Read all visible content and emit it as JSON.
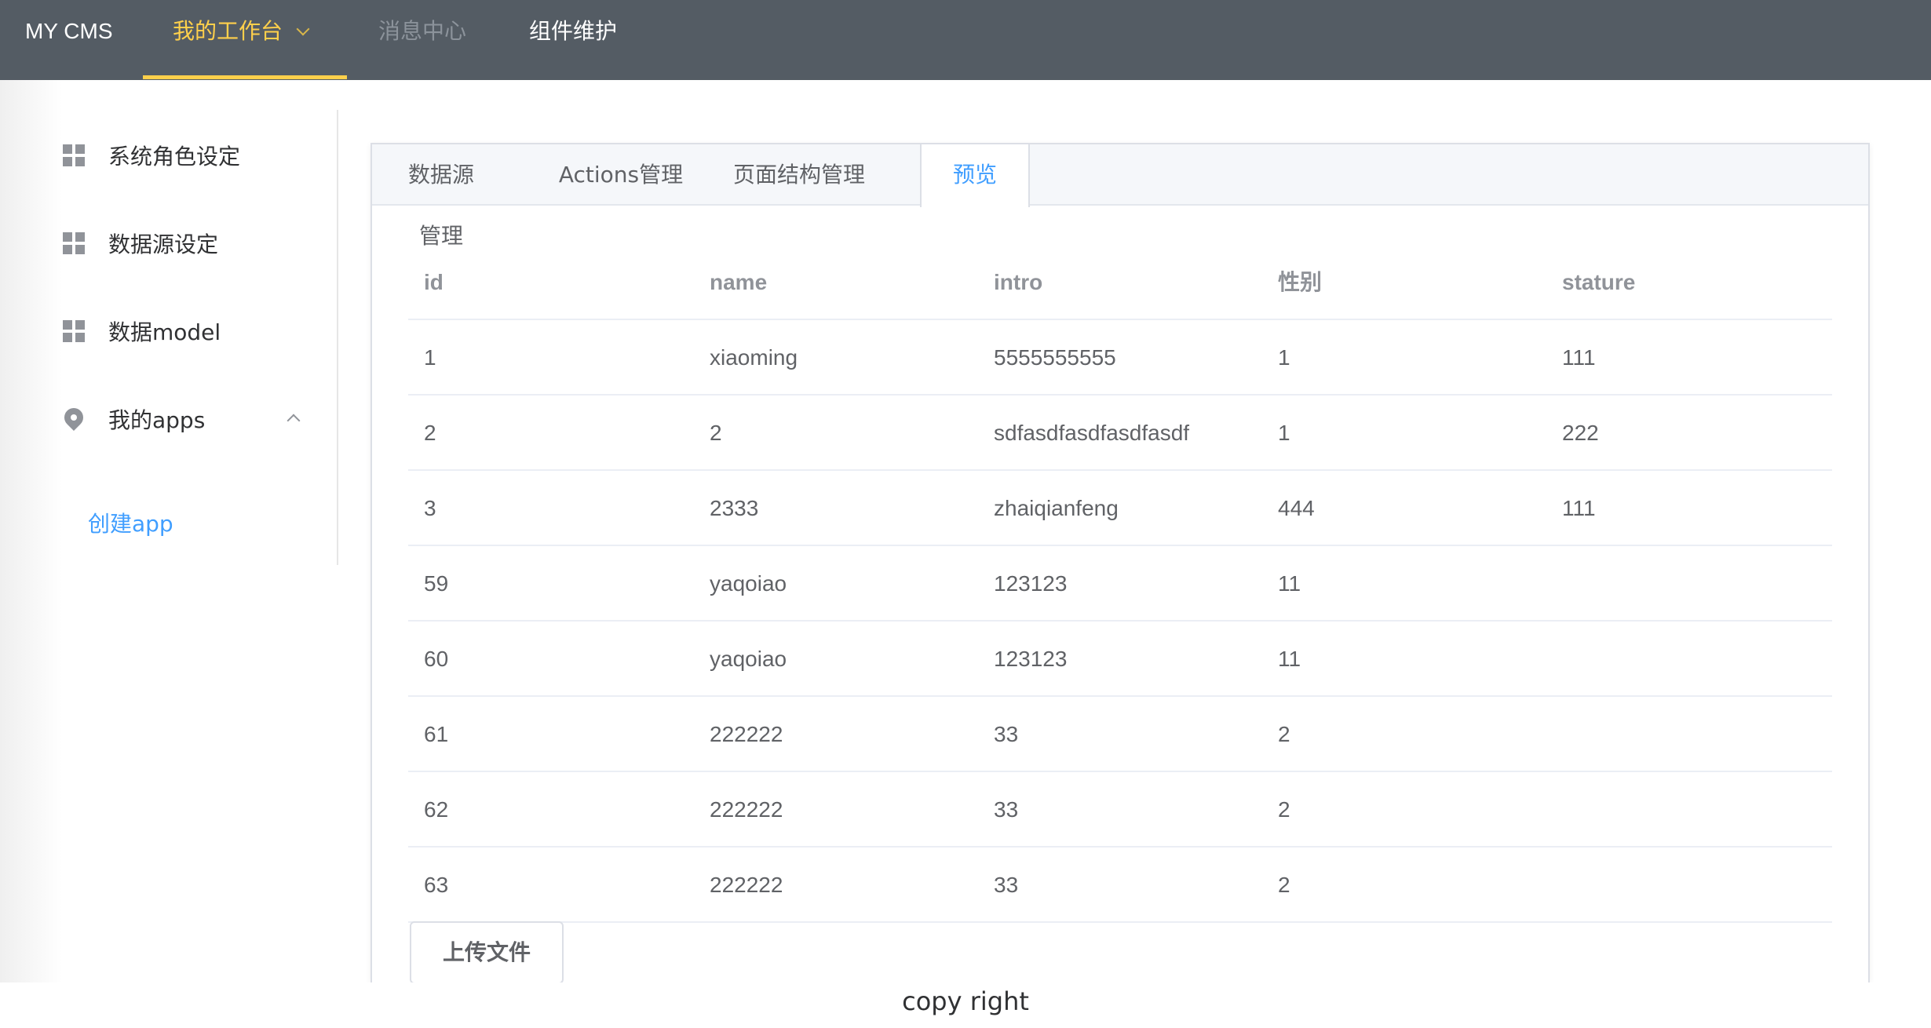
{
  "header": {
    "brand": "MY CMS",
    "nav": [
      {
        "label": "我的工作台",
        "active": true
      },
      {
        "label": "消息中心",
        "disabled": true
      },
      {
        "label": "组件维护"
      }
    ]
  },
  "sidebar": {
    "items": [
      {
        "label": "系统角色设定",
        "icon": "grid-icon"
      },
      {
        "label": "数据源设定",
        "icon": "grid-icon"
      },
      {
        "label": "数据model",
        "icon": "grid-icon"
      },
      {
        "label": "我的apps",
        "icon": "location-pin-icon",
        "expanded": true
      }
    ],
    "sub_items": [
      {
        "label": "创建app"
      }
    ]
  },
  "tabs": [
    {
      "label": "数据源管理"
    },
    {
      "label": "Actions管理"
    },
    {
      "label": "页面结构管理"
    },
    {
      "label": "预览",
      "active": true
    }
  ],
  "table": {
    "columns": [
      "id",
      "name",
      "intro",
      "性别",
      "stature"
    ],
    "rows": [
      [
        "1",
        "xiaoming",
        "5555555555",
        "1",
        "111"
      ],
      [
        "2",
        "2",
        "sdfasdfasdfasdfasdf",
        "1",
        "222"
      ],
      [
        "3",
        "2333",
        "zhaiqianfeng",
        "444",
        "111"
      ],
      [
        "59",
        "yaqoiao",
        "123123",
        "11",
        ""
      ],
      [
        "60",
        "yaqoiao",
        "123123",
        "11",
        ""
      ],
      [
        "61",
        "222222",
        "33",
        "2",
        ""
      ],
      [
        "62",
        "222222",
        "33",
        "2",
        ""
      ],
      [
        "63",
        "222222",
        "33",
        "2",
        ""
      ]
    ]
  },
  "upload_button": "上传文件",
  "footer": "copy right",
  "colors": {
    "nav_bg": "#545c64",
    "nav_active": "#ffd04b",
    "accent": "#409eff"
  }
}
